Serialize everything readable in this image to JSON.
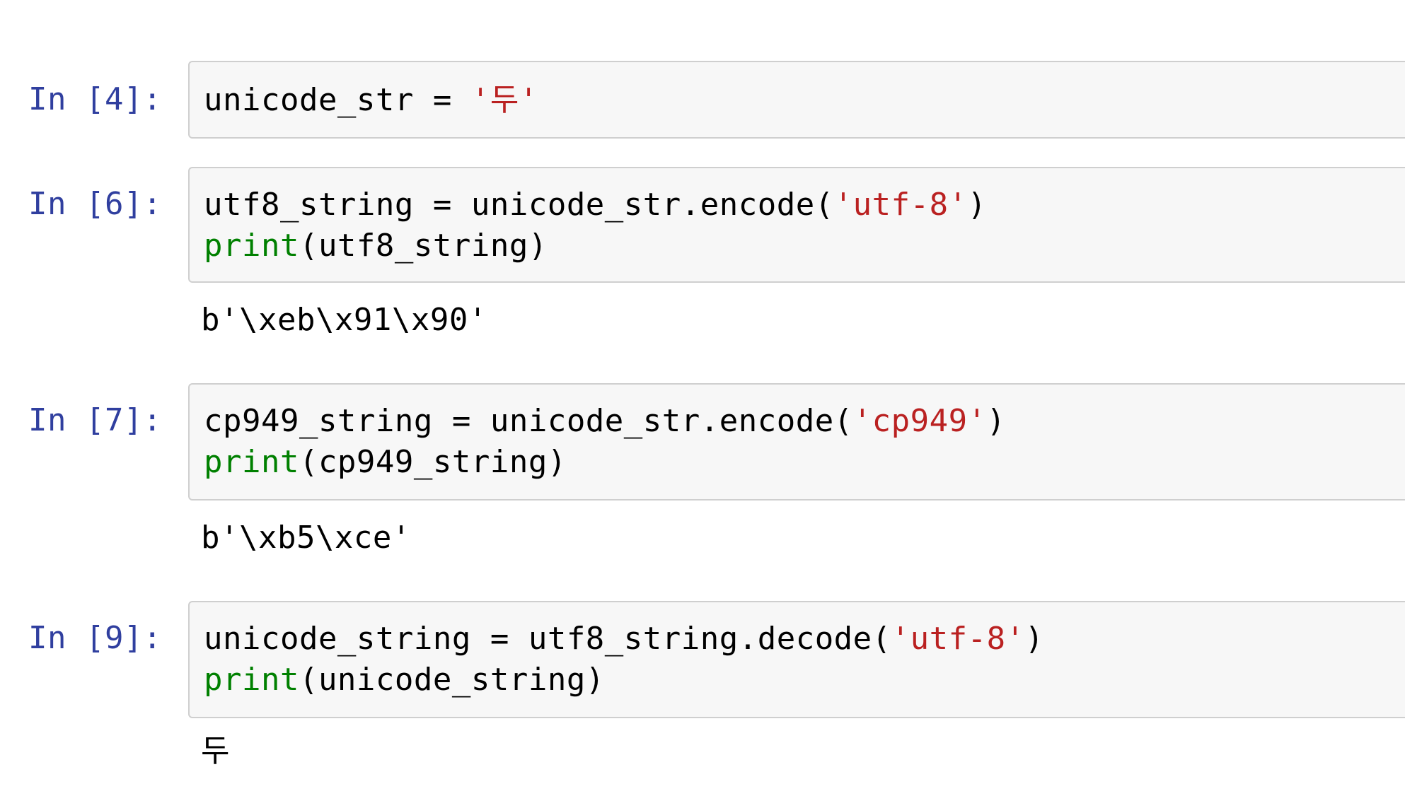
{
  "cells": [
    {
      "prompt": "In [4]:",
      "lines": [
        {
          "code": "unicode_str = ",
          "str": "'두'",
          "rest": ""
        }
      ],
      "output": ""
    },
    {
      "prompt": "In [6]:",
      "lines": [
        {
          "code": "utf8_string = unicode_str.encode(",
          "str": "'utf-8'",
          "rest": ")"
        },
        {
          "builtin": "print",
          "rest": "(utf8_string)"
        }
      ],
      "output": "b'\\xeb\\x91\\x90'"
    },
    {
      "prompt": "In [7]:",
      "lines": [
        {
          "code": "cp949_string = unicode_str.encode(",
          "str": "'cp949'",
          "rest": ")"
        },
        {
          "builtin": "print",
          "rest": "(cp949_string)"
        }
      ],
      "output": "b'\\xb5\\xce'"
    },
    {
      "prompt": "In [9]:",
      "lines": [
        {
          "code": "unicode_string = utf8_string.decode(",
          "str": "'utf-8'",
          "rest": ")"
        },
        {
          "builtin": "print",
          "rest": "(unicode_string)"
        }
      ],
      "output": "두"
    }
  ],
  "colors": {
    "prompt": "#303f9f",
    "builtin": "#008000",
    "string": "#ba2121",
    "cell_background": "#f7f7f7",
    "cell_border": "#cfcfcf"
  }
}
